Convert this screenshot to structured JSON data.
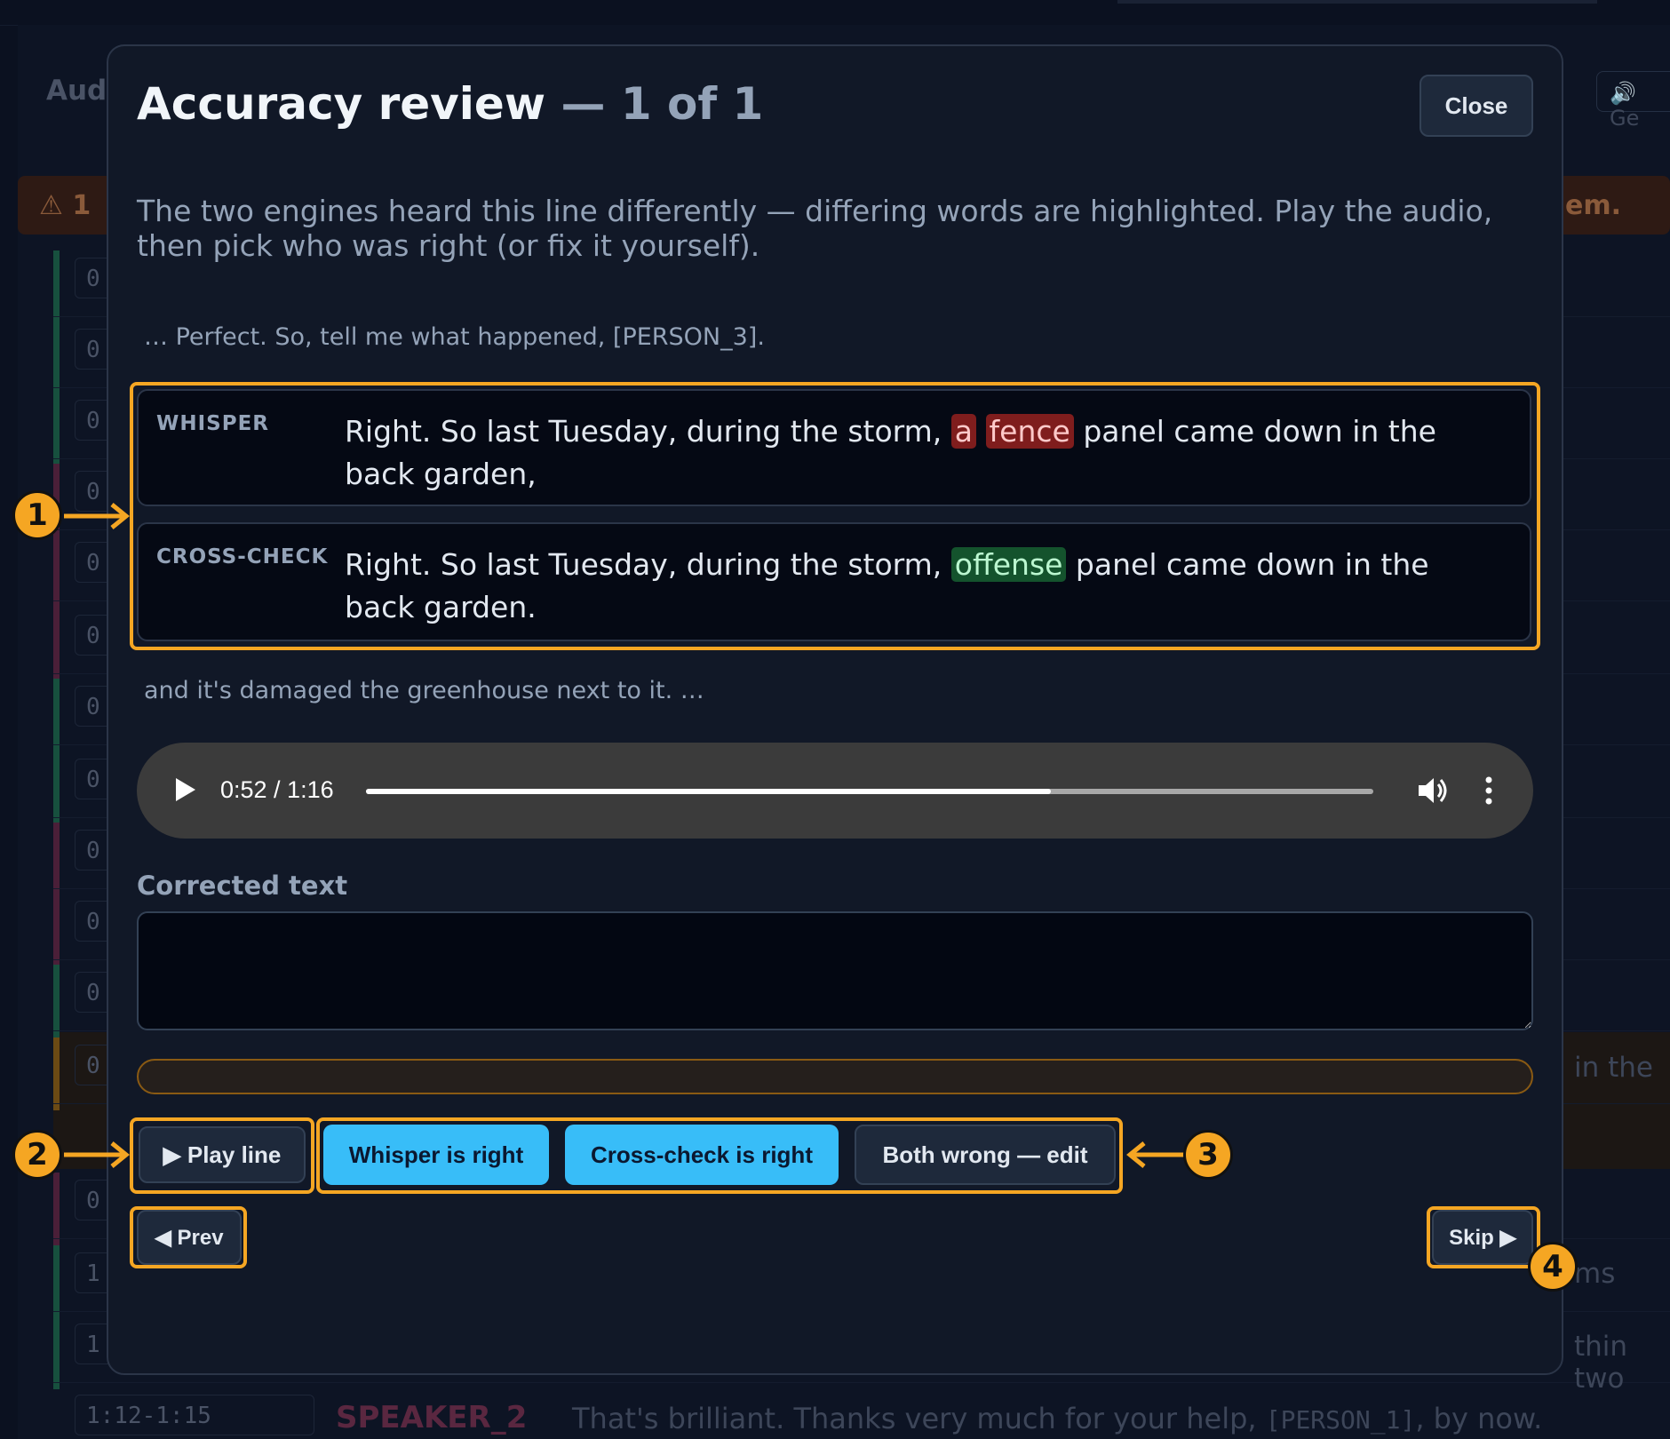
{
  "background": {
    "app_title_fragment": "Aud",
    "generate_button_fragment": "Ge",
    "warning_left_fragment": "⚠ 1",
    "warning_right_fragment": "em.",
    "row_timestamps": [
      "0",
      "0",
      "0",
      "0",
      "0",
      "0",
      "0",
      "0",
      "0",
      "0",
      "0",
      "0",
      "0",
      "1",
      "1"
    ],
    "right_text_fragments": [
      "in the",
      "ms",
      "thin two"
    ],
    "last_row": {
      "time": "1:12-1:15",
      "speaker": "SPEAKER_2",
      "text_before": "That's brilliant. Thanks very much for your help, ",
      "token": "[PERSON_1]",
      "text_after": ", by now."
    }
  },
  "modal": {
    "title": "Accuracy review",
    "counter": "— 1 of 1",
    "close_label": "Close",
    "description": "The two engines heard this line differently — differing words are highlighted. Play the audio, then pick who was right (or fix it yourself).",
    "context_before": "… Perfect. So, tell me what happened, [PERSON_3].",
    "whisper": {
      "label": "WHISPER",
      "pre": "Right. So last Tuesday, during the storm, ",
      "diff_1": "a",
      "diff_2": "fence",
      "post": " panel came down in the back garden,"
    },
    "crosscheck": {
      "label": "CROSS-CHECK",
      "pre": "Right. So last Tuesday, during the storm, ",
      "diff": "offense",
      "post": " panel came down in the back garden."
    },
    "context_after": "and it's damaged the greenhouse next to it. …",
    "audio": {
      "time": "0:52 / 1:16",
      "progress": 0.68
    },
    "corrected_label": "Corrected text",
    "corrected_value": "",
    "buttons": {
      "play_line": "▶ Play line",
      "whisper_right": "Whisper is right",
      "cross_right": "Cross-check is right",
      "both_wrong": "Both wrong — edit",
      "prev": "◀ Prev",
      "skip": "Skip ▶"
    }
  },
  "annotations": {
    "markers": [
      "1",
      "2",
      "3",
      "4"
    ],
    "color": "#f5a623"
  },
  "colors": {
    "accent_blue": "#38bdf8",
    "diff_removed": "#7f1d1d",
    "diff_added": "#14532d",
    "modal_bg": "#111827"
  }
}
